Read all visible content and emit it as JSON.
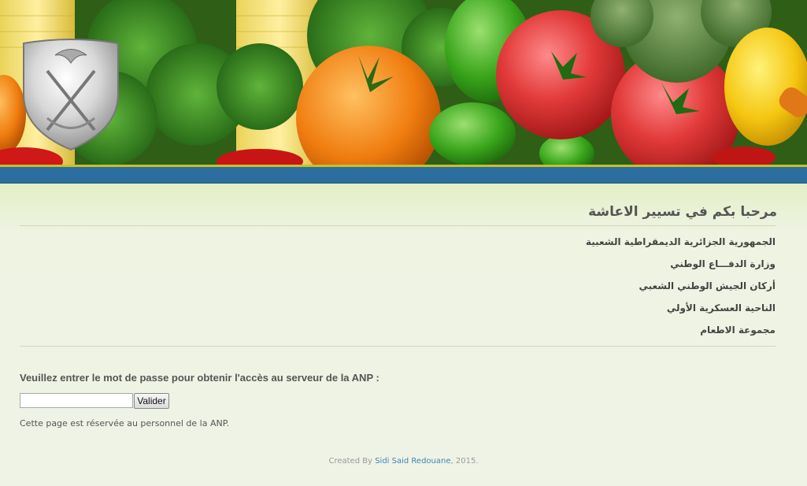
{
  "header": {
    "banner_image": "vegetables-banner",
    "emblem_icon": "military-emblem-icon",
    "colors": {
      "top_band": "#c8c02a",
      "bottom_band": "#2c6ea0"
    }
  },
  "welcome_title": "مرحبا بكم في تسيير الاعاشة",
  "organization_lines": [
    "الجمهورية الجزائرية الديمقراطية الشعبية",
    "وزارة الدفـــاع الوطني",
    "أركان الجيش الوطني الشعبي",
    "الناحية العسكرية الأولي",
    "مجموعة الاطعام"
  ],
  "login": {
    "prompt": "Veuillez entrer le mot de passe pour obtenir l'accès au serveur de la ANP :",
    "password_value": "",
    "submit_label": "Valider",
    "note": "Cette page est réservée au personnel de la ANP."
  },
  "footer": {
    "prefix": "Created By ",
    "author": "Sidi Said Redouane",
    "suffix": ", 2015."
  },
  "colors": {
    "link": "#3e86b3",
    "page_background": "#eef3e2"
  }
}
